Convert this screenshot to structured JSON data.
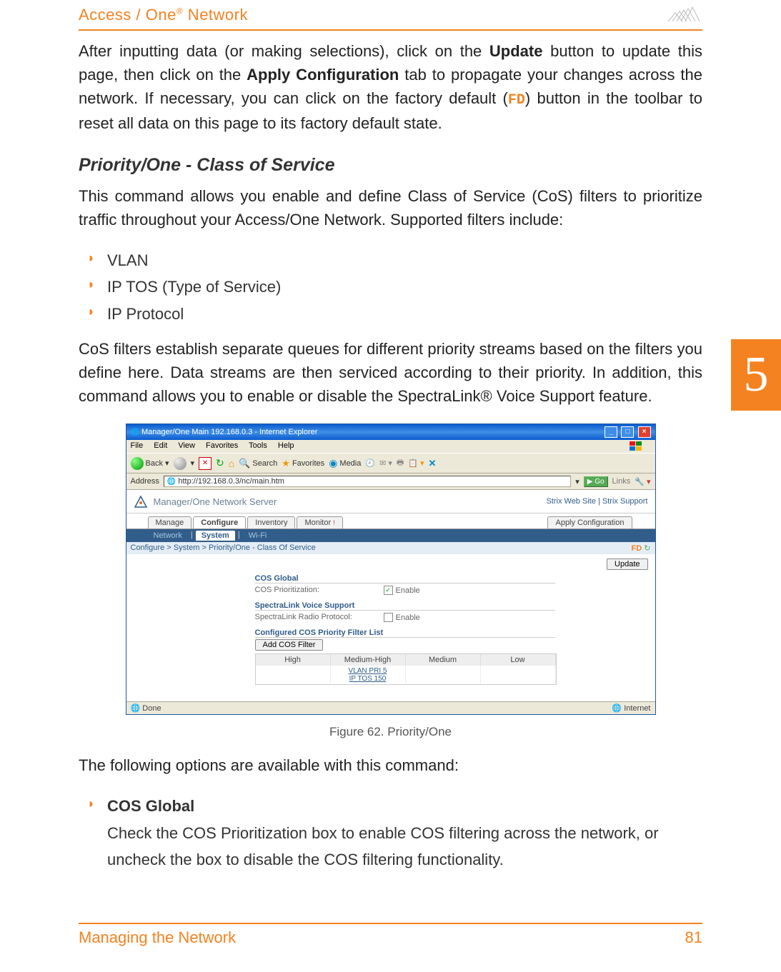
{
  "header": {
    "title_pre": "Access / One",
    "title_sup": "®",
    "title_post": " Network"
  },
  "paragraphs": {
    "p1_part1": "After inputting data (or making selections), click on the ",
    "p1_bold1": "Update",
    "p1_part2": " button to update this page, then click on the ",
    "p1_bold2": "Apply Configuration",
    "p1_part3": " tab to propagate your changes across the network. If necessary, you can click on the factory default (",
    "p1_fd": "FD",
    "p1_part4": ") button in the toolbar to reset all data on this page to its factory default state.",
    "p2": "This command allows you enable and define Class of Service (CoS) filters to prioritize traffic throughout your Access/One Network. Supported filters include:",
    "p3": "CoS filters establish separate queues for different priority streams based on the filters you define here. Data streams are then serviced according to their priority. In addition, this command allows you to enable or disable the SpectraLink® Voice Support feature.",
    "p4": "The following options are available with this command:"
  },
  "section_heading": "Priority/One - Class of Service",
  "bullets1": [
    "VLAN",
    "IP TOS (Type of Service)",
    "IP Protocol"
  ],
  "chapter_number": "5",
  "screenshot": {
    "titlebar": "Manager/One Main 192.168.0.3 - Internet Explorer",
    "menu": [
      "File",
      "Edit",
      "View",
      "Favorites",
      "Tools",
      "Help"
    ],
    "toolbar": {
      "back": "Back",
      "search": "Search",
      "favorites": "Favorites",
      "media": "Media"
    },
    "address_label": "Address",
    "address_value": "http://192.168.0.3/nc/main.htm",
    "go": "Go",
    "links": "Links",
    "app_title": "Manager/One Network Server",
    "top_links": "Strix Web Site  |  Strix Support",
    "main_tabs": [
      "Manage",
      "Configure",
      "Inventory",
      "Monitor"
    ],
    "apply_tab": "Apply Configuration",
    "sub_tabs": [
      "Network",
      "System",
      "Wi-Fi"
    ],
    "breadcrumb": "Configure > System > Priority/One - Class Of Service",
    "fd_label": "FD",
    "update_btn": "Update",
    "cos_global": {
      "title": "COS Global",
      "label": "COS Prioritization:",
      "value": "Enable",
      "checked": true
    },
    "spectralink": {
      "title": "SpectraLink Voice Support",
      "label": "SpectraLink Radio Protocol:",
      "value": "Enable",
      "checked": false
    },
    "filter_list": {
      "title": "Configured COS Priority Filter List",
      "add_btn": "Add COS Filter",
      "columns": [
        "High",
        "Medium-High",
        "Medium",
        "Low"
      ],
      "items": [
        "VLAN PRI 5",
        "IP TOS 150"
      ]
    },
    "status_done": "Done",
    "status_zone": "Internet"
  },
  "caption": "Figure 62. Priority/One",
  "option": {
    "title": "COS Global",
    "desc": "Check the COS Prioritization box to enable COS filtering across the network, or uncheck the box to disable the COS filtering functionality."
  },
  "footer": {
    "left": "Managing the Network",
    "right": "81"
  }
}
